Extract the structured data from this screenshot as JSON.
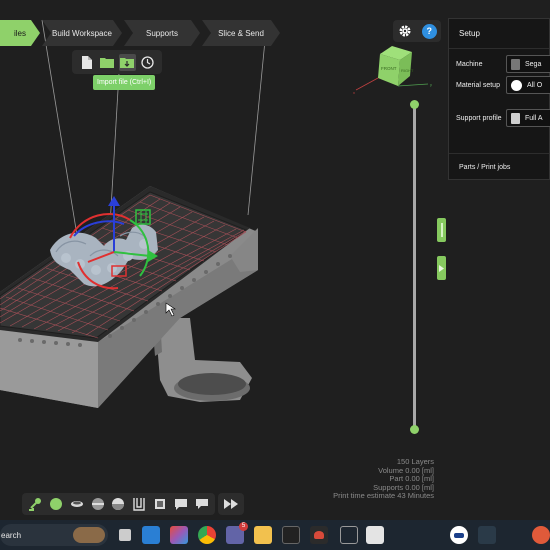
{
  "workflow": {
    "steps": [
      {
        "label": "Files",
        "shown": "iles",
        "active": true
      },
      {
        "label": "Build Workspace",
        "active": false
      },
      {
        "label": "Supports",
        "active": false
      },
      {
        "label": "Slice & Send",
        "active": false
      }
    ]
  },
  "toolbar": {
    "icons": [
      "new-file-icon",
      "open-folder-icon",
      "import-file-icon",
      "history-icon"
    ],
    "tooltip": "Import file (Ctrl+I)"
  },
  "top_buttons": {
    "settings_icon": "gear-icon",
    "help_icon": "help-icon",
    "help_color": "#2f8fe0"
  },
  "viewcube": {
    "face_front": "FRONT",
    "face_right": "RIGHT",
    "color": "#8fd16a"
  },
  "setup_panel": {
    "title": "Setup",
    "machine_label": "Machine",
    "machine_value": "Sega",
    "material_label": "Material setup",
    "material_value": "All O",
    "support_label": "Support profile",
    "support_value": "Full A",
    "parts_title": "Parts / Print jobs"
  },
  "stats": {
    "layers": "150 Layers",
    "volume": "Volume 0.00  [ml]",
    "part": "Part 0.00  [ml]",
    "supports": "Supports 0.00  [ml]",
    "print_time": "Print time estimate 43 Minutes"
  },
  "bottom_toolbar": {
    "icons": [
      "move-icon",
      "sphere-icon",
      "bowl-icon",
      "half-sphere-icon",
      "shaded-sphere-icon",
      "wireframe-box-icon",
      "cube-icon",
      "comment-icon",
      "chat-icon"
    ],
    "play_icon": "fast-forward-icon"
  },
  "taskbar": {
    "search_text": "earch",
    "badge_count": "5",
    "accent": "#8fd16a"
  }
}
